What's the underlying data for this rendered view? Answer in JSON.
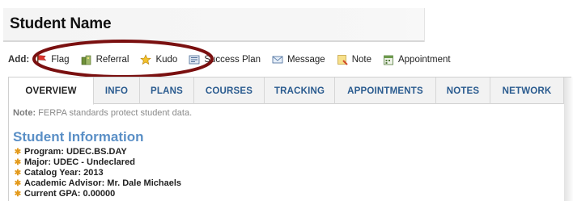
{
  "header": {
    "title": "Student Name"
  },
  "add_bar": {
    "label": "Add:",
    "items": [
      {
        "label": "Flag",
        "icon": "flag-icon"
      },
      {
        "label": "Referral",
        "icon": "referral-icon"
      },
      {
        "label": "Kudo",
        "icon": "kudo-star-icon"
      },
      {
        "label": "Success Plan",
        "icon": "success-plan-icon"
      },
      {
        "label": "Message",
        "icon": "message-icon"
      },
      {
        "label": "Note",
        "icon": "note-icon"
      },
      {
        "label": "Appointment",
        "icon": "appointment-icon"
      }
    ]
  },
  "tabs": [
    {
      "label": "OVERVIEW",
      "active": true
    },
    {
      "label": "INFO"
    },
    {
      "label": "PLANS"
    },
    {
      "label": "COURSES"
    },
    {
      "label": "TRACKING"
    },
    {
      "label": "APPOINTMENTS"
    },
    {
      "label": "NOTES"
    },
    {
      "label": "NETWORK"
    }
  ],
  "note": {
    "prefix": "Note:",
    "text": " FERPA standards protect student data."
  },
  "student_info": {
    "title": "Student Information",
    "items": [
      "Program: UDEC.BS.DAY",
      "Major: UDEC - Undeclared",
      "Catalog Year: 2013",
      "Academic Advisor: Mr. Dale Michaels",
      "Current GPA: 0.00000"
    ]
  },
  "colors": {
    "tab_text": "#2a5b8f",
    "section_title": "#5a8fc6",
    "highlight": "#7a1010",
    "bullet": "#e39a1c"
  }
}
